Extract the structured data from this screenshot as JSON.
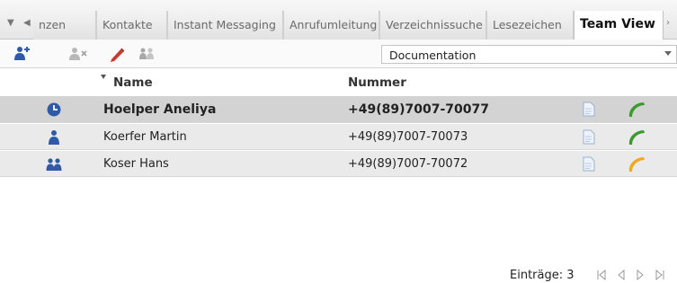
{
  "tabs": {
    "items": [
      {
        "label": "nzen"
      },
      {
        "label": "Kontakte"
      },
      {
        "label": "Instant Messaging"
      },
      {
        "label": "Anrufumleitung"
      },
      {
        "label": "Verzeichnissuche"
      },
      {
        "label": "Lesezeichen"
      },
      {
        "label": "Team View"
      }
    ],
    "active": "Team View"
  },
  "toolbar": {
    "icons": [
      "add-user-icon",
      "remove-user-icon",
      "edit-icon",
      "group-icon"
    ],
    "dropdown_value": "Documentation"
  },
  "table": {
    "columns": [
      "Name",
      "Nummer"
    ],
    "sort_column": "Name",
    "rows": [
      {
        "name": "Hoelper Aneliya",
        "number": "+49(89)7007-70077",
        "status_icon": "clock-icon",
        "phone_color": "#3d9a2e"
      },
      {
        "name": "Koerfer Martin",
        "number": "+49(89)7007-70073",
        "status_icon": "person-icon",
        "phone_color": "#3d9a2e"
      },
      {
        "name": "Koser Hans",
        "number": "+49(89)7007-70072",
        "status_icon": "group-icon",
        "phone_color": "#f0a821"
      }
    ]
  },
  "footer": {
    "entries_label": "Einträge: 3"
  },
  "colors": {
    "accent_blue": "#2e5aa8",
    "phone_green": "#3d9a2e",
    "phone_orange": "#f0a821"
  }
}
